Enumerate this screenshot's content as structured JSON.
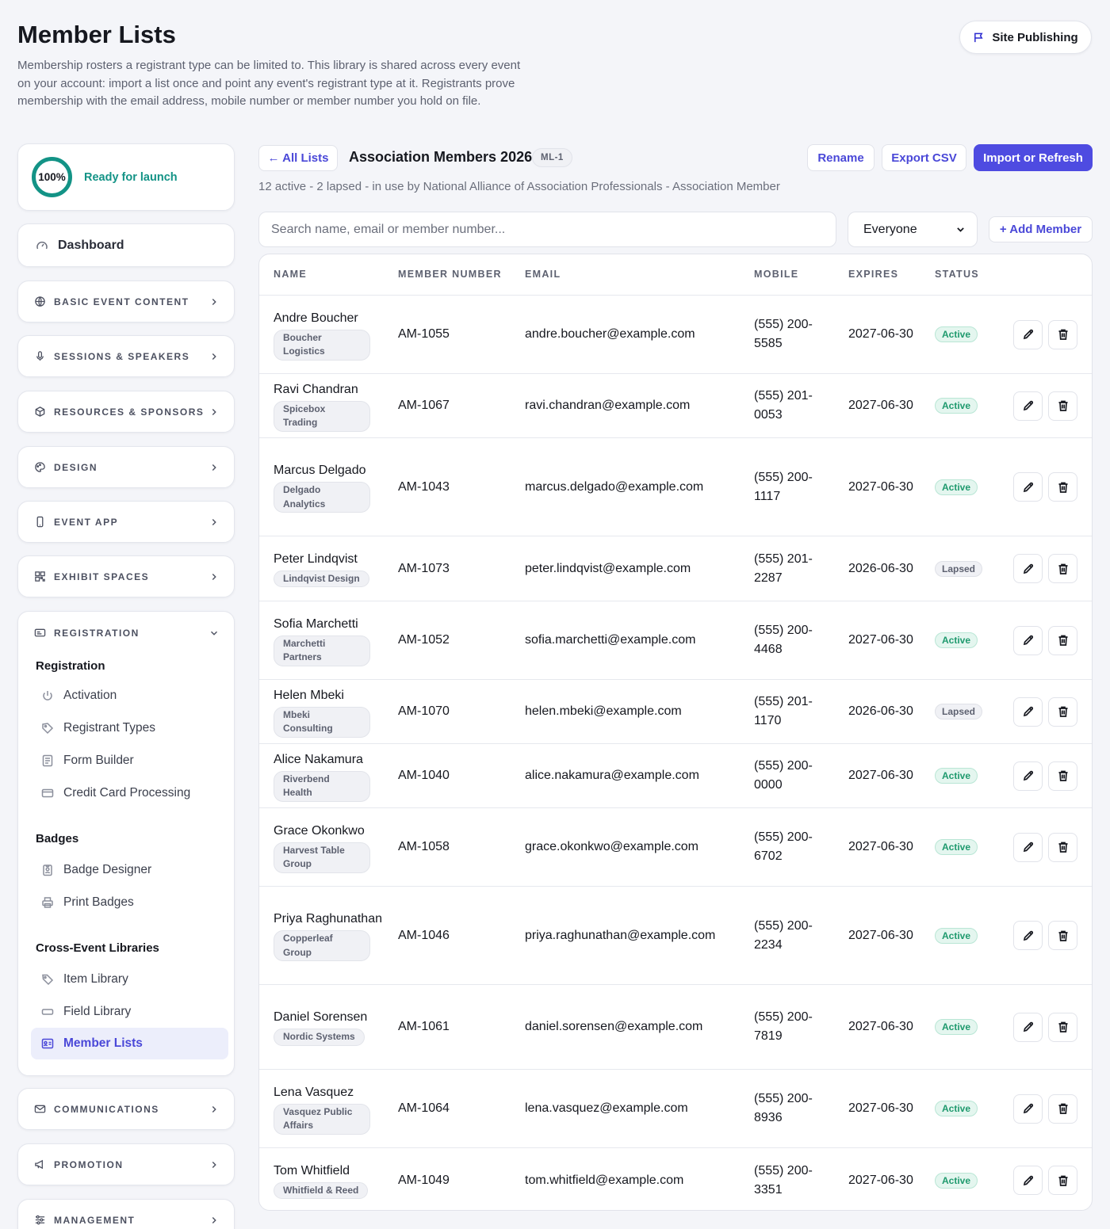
{
  "header": {
    "title": "Member Lists",
    "description": "Membership rosters a registrant type can be limited to. This library is shared across every event on your account: import a list once and point any event's registrant type at it. Registrants prove membership with the email address, mobile number or member number you hold on file.",
    "site_publishing_label": "Site Publishing"
  },
  "sidebar": {
    "progress": {
      "percent_label": "100%",
      "value": 1.0,
      "status": "Ready for launch"
    },
    "dashboard_label": "Dashboard",
    "sections": {
      "basic": "BASIC EVENT CONTENT",
      "sessions": "SESSIONS & SPEAKERS",
      "resources": "RESOURCES & SPONSORS",
      "design": "DESIGN",
      "event_app": "EVENT APP",
      "exhibit": "EXHIBIT SPACES",
      "registration": "REGISTRATION",
      "communications": "COMMUNICATIONS",
      "promotion": "PROMOTION",
      "management": "MANAGEMENT"
    },
    "registration": {
      "groups": {
        "registration": "Registration",
        "badges": "Badges",
        "libraries": "Cross-Event Libraries"
      },
      "items": {
        "activation": "Activation",
        "registrant_types": "Registrant Types",
        "form_builder": "Form Builder",
        "credit_card": "Credit Card Processing",
        "badge_designer": "Badge Designer",
        "print_badges": "Print Badges",
        "item_library": "Item Library",
        "field_library": "Field Library",
        "member_lists": "Member Lists"
      }
    }
  },
  "main": {
    "back_label": "← All Lists",
    "list_title": "Association Members 2026",
    "list_code": "ML-1",
    "rename_label": "Rename",
    "export_label": "Export CSV",
    "import_label": "Import or Refresh",
    "meta": "12 active - 2 lapsed - in use by National Alliance of Association Professionals - Association Member",
    "search_placeholder": "Search name, email or member number...",
    "filter_value": "Everyone",
    "add_member_label": "+ Add Member"
  },
  "table": {
    "columns": {
      "name": "NAME",
      "member_number": "MEMBER NUMBER",
      "email": "EMAIL",
      "mobile": "MOBILE",
      "expires": "EXPIRES",
      "status": "STATUS"
    },
    "rows": [
      {
        "name": "Andre Boucher",
        "org": "Boucher Logistics",
        "number": "AM-1055",
        "email": "andre.boucher@example.com",
        "mobile": "(555) 200-5585",
        "expires": "2027-06-30",
        "status": "Active"
      },
      {
        "name": "Ravi Chandran",
        "org": "Spicebox Trading",
        "number": "AM-1067",
        "email": "ravi.chandran@example.com",
        "mobile": "(555) 201-0053",
        "expires": "2027-06-30",
        "status": "Active"
      },
      {
        "name": "Marcus Delgado",
        "org": "Delgado Analytics",
        "number": "AM-1043",
        "email": "marcus.delgado@example.com",
        "mobile": "(555) 200-1117",
        "expires": "2027-06-30",
        "status": "Active"
      },
      {
        "name": "Peter Lindqvist",
        "org": "Lindqvist Design",
        "number": "AM-1073",
        "email": "peter.lindqvist@example.com",
        "mobile": "(555) 201-2287",
        "expires": "2026-06-30",
        "status": "Lapsed"
      },
      {
        "name": "Sofia Marchetti",
        "org": "Marchetti Partners",
        "number": "AM-1052",
        "email": "sofia.marchetti@example.com",
        "mobile": "(555) 200-4468",
        "expires": "2027-06-30",
        "status": "Active"
      },
      {
        "name": "Helen Mbeki",
        "org": "Mbeki Consulting",
        "number": "AM-1070",
        "email": "helen.mbeki@example.com",
        "mobile": "(555) 201-1170",
        "expires": "2026-06-30",
        "status": "Lapsed"
      },
      {
        "name": "Alice Nakamura",
        "org": "Riverbend Health",
        "number": "AM-1040",
        "email": "alice.nakamura@example.com",
        "mobile": "(555) 200-0000",
        "expires": "2027-06-30",
        "status": "Active"
      },
      {
        "name": "Grace Okonkwo",
        "org": "Harvest Table Group",
        "number": "AM-1058",
        "email": "grace.okonkwo@example.com",
        "mobile": "(555) 200-6702",
        "expires": "2027-06-30",
        "status": "Active"
      },
      {
        "name": "Priya Raghunathan",
        "org": "Copperleaf Group",
        "number": "AM-1046",
        "email": "priya.raghunathan@example.com",
        "mobile": "(555) 200-2234",
        "expires": "2027-06-30",
        "status": "Active"
      },
      {
        "name": "Daniel Sorensen",
        "org": "Nordic Systems",
        "number": "AM-1061",
        "email": "daniel.sorensen@example.com",
        "mobile": "(555) 200-7819",
        "expires": "2027-06-30",
        "status": "Active"
      },
      {
        "name": "Lena Vasquez",
        "org": "Vasquez Public Affairs",
        "number": "AM-1064",
        "email": "lena.vasquez@example.com",
        "mobile": "(555) 200-8936",
        "expires": "2027-06-30",
        "status": "Active"
      },
      {
        "name": "Tom Whitfield",
        "org": "Whitfield & Reed",
        "number": "AM-1049",
        "email": "tom.whitfield@example.com",
        "mobile": "(555) 200-3351",
        "expires": "2027-06-30",
        "status": "Active"
      }
    ]
  },
  "icons": [
    "flag-icon",
    "gauge-icon",
    "globe-icon",
    "microphone-icon",
    "cube-icon",
    "palette-icon",
    "phone-icon",
    "grid-icon",
    "id-card-icon",
    "power-icon",
    "tag-icon",
    "list-icon",
    "credit-card-icon",
    "badge-icon",
    "printer-icon",
    "field-icon",
    "mail-icon",
    "megaphone-icon",
    "sliders-icon",
    "pencil-icon",
    "trash-icon",
    "chevron-right-icon",
    "chevron-down-icon"
  ],
  "colors": {
    "accent": "#4e4be1",
    "success": "#1f9a6e",
    "ring": "#139386"
  }
}
